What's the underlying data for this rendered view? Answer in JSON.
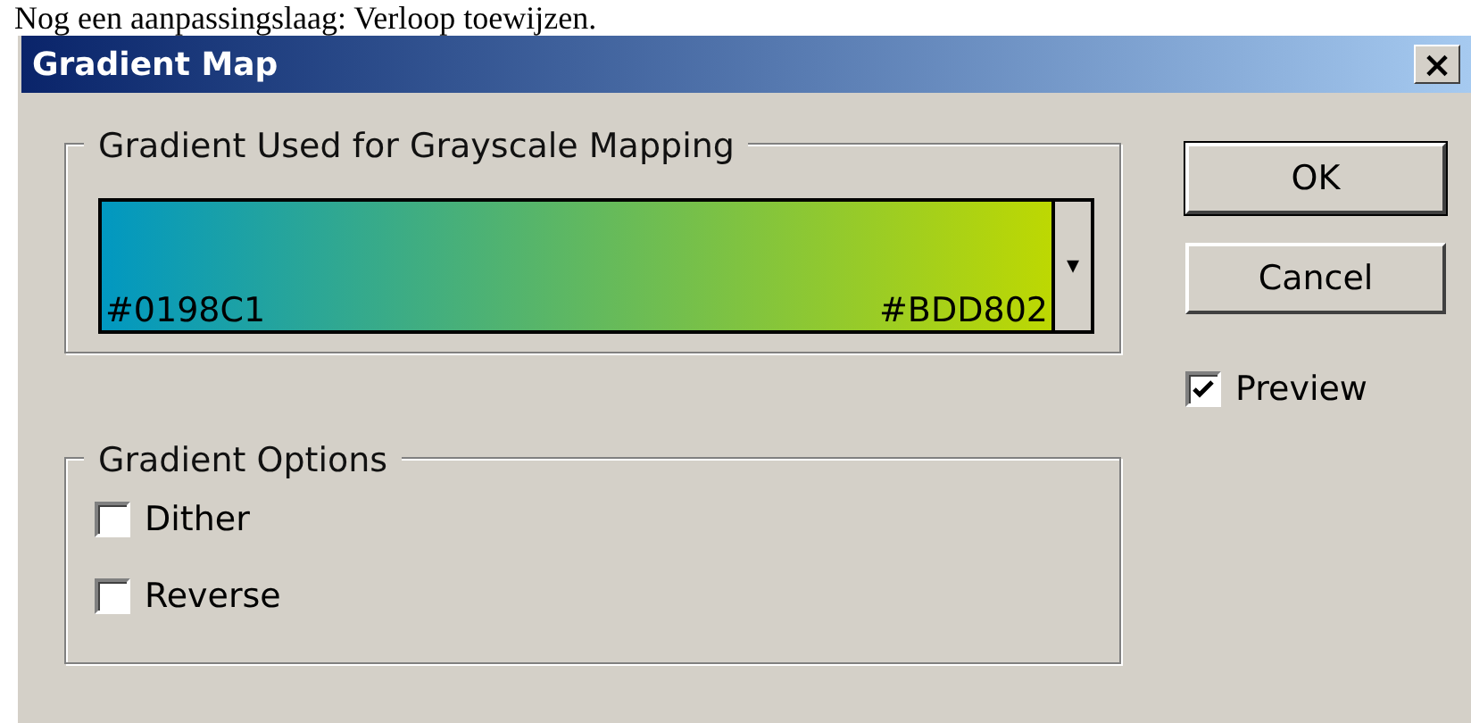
{
  "page_caption": "Nog een aanpassingslaag: Verloop toewijzen.",
  "window": {
    "title": "Gradient Map",
    "close": "×"
  },
  "gradient_group": {
    "title": "Gradient Used for Grayscale Mapping",
    "dropdown": "▾",
    "stops": [
      {
        "label": "#0198C1",
        "color": "#0198c1"
      },
      {
        "label": "#BDD802",
        "color": "#bdd802"
      }
    ]
  },
  "options_group": {
    "title": "Gradient Options",
    "items": [
      {
        "label": "Dither",
        "checked": false
      },
      {
        "label": "Reverse",
        "checked": false
      }
    ]
  },
  "buttons": [
    {
      "label": "OK",
      "default": true
    },
    {
      "label": "Cancel",
      "default": false
    }
  ],
  "preview": {
    "label": "Preview",
    "checked": true
  }
}
